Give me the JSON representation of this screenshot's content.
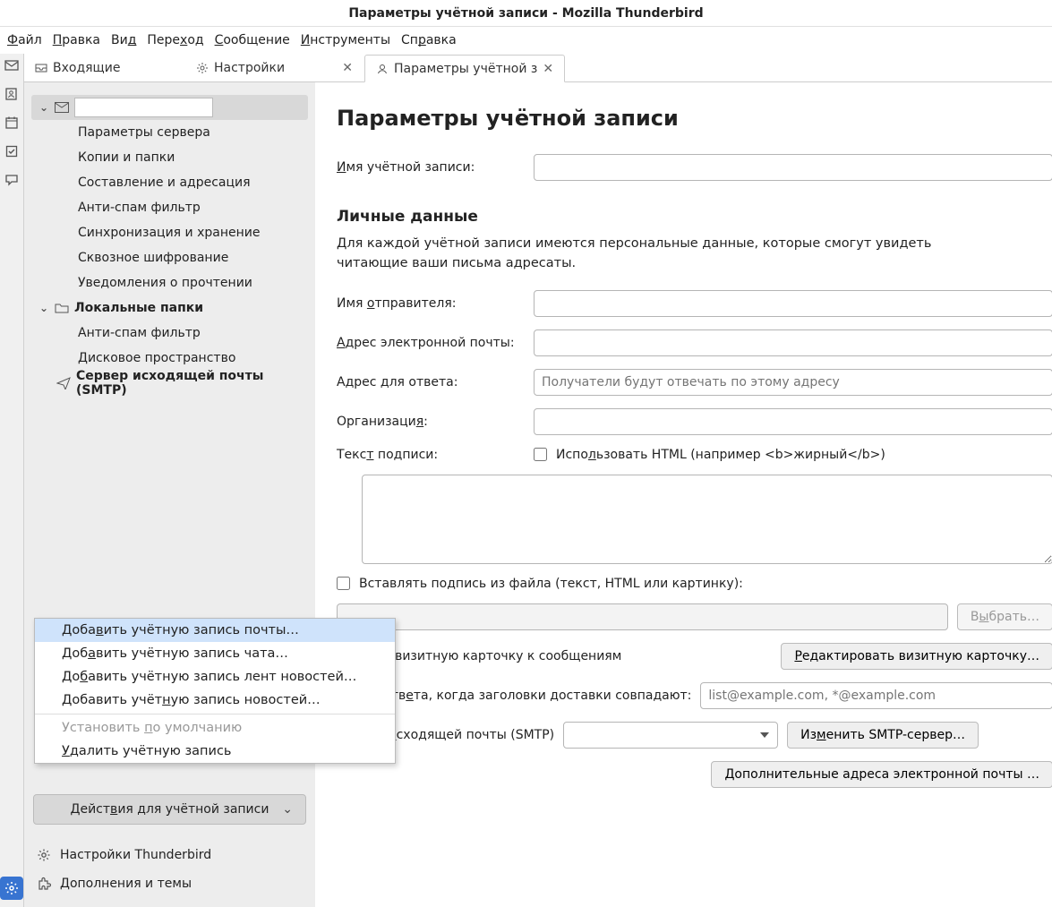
{
  "window_title": "Параметры учётной записи - Mozilla Thunderbird",
  "menubar": [
    "Файл",
    "Правка",
    "Вид",
    "Переход",
    "Сообщение",
    "Инструменты",
    "Справка"
  ],
  "tabs": {
    "inbox": "Входящие",
    "settings": "Настройки",
    "account": "Параметры учётной з"
  },
  "tree": {
    "items": [
      "Параметры сервера",
      "Копии и папки",
      "Составление и адресация",
      "Анти-спам фильтр",
      "Синхронизация и хранение",
      "Сквозное шифрование",
      "Уведомления о прочтении"
    ],
    "local_folders": "Локальные папки",
    "local_children": [
      "Анти-спам фильтр",
      "Дисковое пространство"
    ],
    "smtp": "Сервер исходящей почты (SMTP)"
  },
  "sidebar": {
    "actions_btn": "Действия для учётной записи",
    "thunderbird_settings": "Настройки Thunderbird",
    "addons": "Дополнения и темы"
  },
  "popup": {
    "add_mail": "Добавить учётную запись почты…",
    "add_chat": "Добавить учётную запись чата…",
    "add_feed": "Добавить учётную запись лент новостей…",
    "add_news": "Добавить учётную запись новостей…",
    "set_default": "Установить по умолчанию",
    "delete": "Удалить учётную запись"
  },
  "main": {
    "heading": "Параметры учётной записи",
    "account_name_label": "Имя учётной записи:",
    "personal_h": "Личные данные",
    "personal_desc": "Для каждой учётной записи имеются персональные данные, которые смогут увидеть читающие ваши письма адресаты.",
    "sender_name": "Имя отправителя:",
    "email": "Адрес электронной почты:",
    "reply_to": "Адрес для ответа:",
    "reply_to_ph": "Получатели будут отвечать по этому адресу",
    "org": "Организация:",
    "sig_text": "Текст подписи:",
    "use_html": "Использовать HTML (например <b>жирный</b>)",
    "sig_file": "Вставлять подпись из файла (текст, HTML или картинку):",
    "browse": "Выбрать…",
    "attach_vcard": "крепить визитную карточку к сообщениям",
    "edit_vcard": "Редактировать визитную карточку…",
    "reply_match": "ес для ответа, когда заголовки доставки совпадают:",
    "reply_match_ph": "list@example.com, *@example.com",
    "smtp_label": "Сервер исходящей почты (SMTP)",
    "edit_smtp": "Изменить SMTP-сервер…",
    "more_emails": "Дополнительные адреса электронной почты …"
  }
}
